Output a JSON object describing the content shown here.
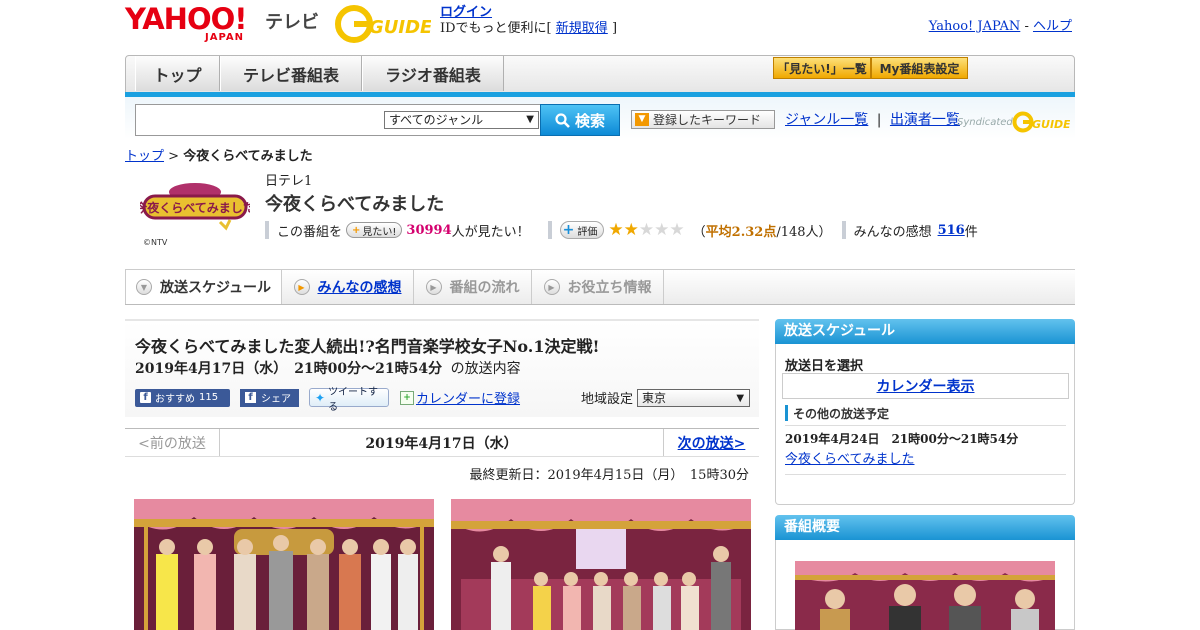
{
  "header": {
    "yahoo_text": "YAHOO!",
    "japan_text": "JAPAN",
    "tv_text": "テレビ",
    "gguide_text": "G GUIDE",
    "login": "ログイン",
    "login_sub_prefix": "IDでもっと便利に[",
    "register": "新規取得",
    "login_sub_suffix": "]",
    "yahoo_japan_link": "Yahoo! JAPAN",
    "sep": " - ",
    "help_link": "ヘルプ"
  },
  "nav": {
    "tabs": [
      "トップ",
      "テレビ番組表",
      "ラジオ番組表"
    ],
    "mitai_list": "「見たい!」一覧",
    "my_schedule": "My番組表設定"
  },
  "search": {
    "placeholder": "",
    "genre_selected": "すべてのジャンル",
    "search_button": "検索",
    "keyword_button": "登録したキーワード",
    "genre_list": "ジャンル一覧",
    "divider": "|",
    "performer_list": "出演者一覧",
    "syndicated": "Syndicated"
  },
  "breadcrumb": {
    "top": "トップ",
    "sep": " > ",
    "current": "今夜くらべてみました"
  },
  "program": {
    "logo_text": "今夜くらべてみました",
    "copyright": "©NTV",
    "station": "日テレ1",
    "title": "今夜くらべてみました",
    "mitai_prefix": "この番組を",
    "mitai_button": "見たい!",
    "mitai_count": "30994",
    "mitai_suffix": "人が見たい！",
    "rating_button": "評価",
    "rating_value": 2.32,
    "stars": [
      "★",
      "★",
      "★",
      "★",
      "★"
    ],
    "avg_open": "（",
    "avg_label": "平均2.32点",
    "avg_count": "/148人",
    "avg_close": "）",
    "kansou_label": "みんなの感想",
    "kansou_count": "516",
    "kansou_unit": "件"
  },
  "tabs": [
    {
      "label": "放送スケジュール",
      "state": "active"
    },
    {
      "label": "みんなの感想",
      "state": "link"
    },
    {
      "label": "番組の流れ",
      "state": "disabled"
    },
    {
      "label": "お役立ち情報",
      "state": "disabled"
    }
  ],
  "episode": {
    "title": "今夜くらべてみました変人続出!?名門音楽学校女子No.1決定戦!",
    "date": "2019年4月17日（水）　21時00分～21時54分",
    "date_suffix": "の放送内容",
    "fb_like": "おすすめ",
    "fb_count": "115",
    "fb_share": "シェア",
    "tweet": "ツイートする",
    "calendar_add": "カレンダーに登録",
    "region_label": "地域設定",
    "region_value": "東京",
    "prev": "<前の放送",
    "current_date": "2019年4月17日（水）",
    "next": "次の放送>",
    "updated": "最終更新日：2019年4月15日（月）　15時30分"
  },
  "sidebar": {
    "schedule_head": "放送スケジュール",
    "select_date": "放送日を選択",
    "calendar_show": "カレンダー表示",
    "other_head": "その他の放送予定",
    "other_date": "2019年4月24日　21時00分～21時54分",
    "other_link": "今夜くらべてみました",
    "overview_head": "番組概要"
  },
  "colors": {
    "brand_red": "#e60012",
    "accent_blue": "#1a93d3",
    "link": "#0033cc",
    "count_pink": "#d4006e",
    "star_on": "#f0a800"
  }
}
